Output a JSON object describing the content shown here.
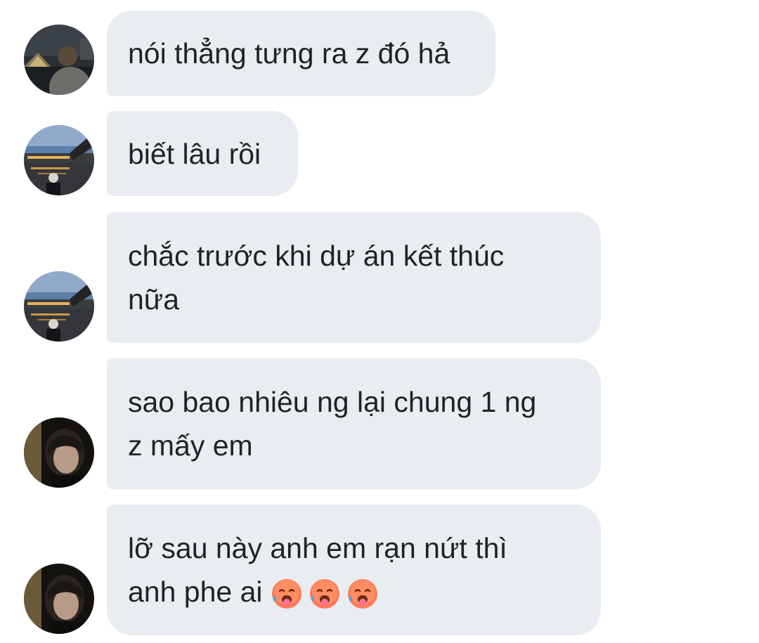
{
  "conversation": {
    "messages": [
      {
        "text": "nói thẳng tưng ra z đó hả",
        "avatar": "night-plaza-avatar"
      },
      {
        "text": "biết lâu rồi",
        "avatar": "river-bridge-avatar"
      },
      {
        "text": "chắc trước khi dự án kết thúc\nnữa",
        "line1": "chắc trước khi dự án kết thúc",
        "line2": "nữa",
        "avatar": "river-bridge-avatar"
      },
      {
        "line1": "sao bao nhiêu ng lại chung 1 ng",
        "line2": "z mấy em",
        "avatar": "dark-portrait-avatar"
      },
      {
        "line1": "lỡ sau này anh em rạn nứt thì",
        "line2": "anh phe ai",
        "emojis": [
          "drooling-sweat-face",
          "drooling-sweat-face",
          "drooling-sweat-face"
        ],
        "avatar": "dark-portrait-avatar"
      }
    ]
  },
  "colors": {
    "bubble_bg": "#e9edf1",
    "text": "#1f2328",
    "background": "#ffffff"
  }
}
